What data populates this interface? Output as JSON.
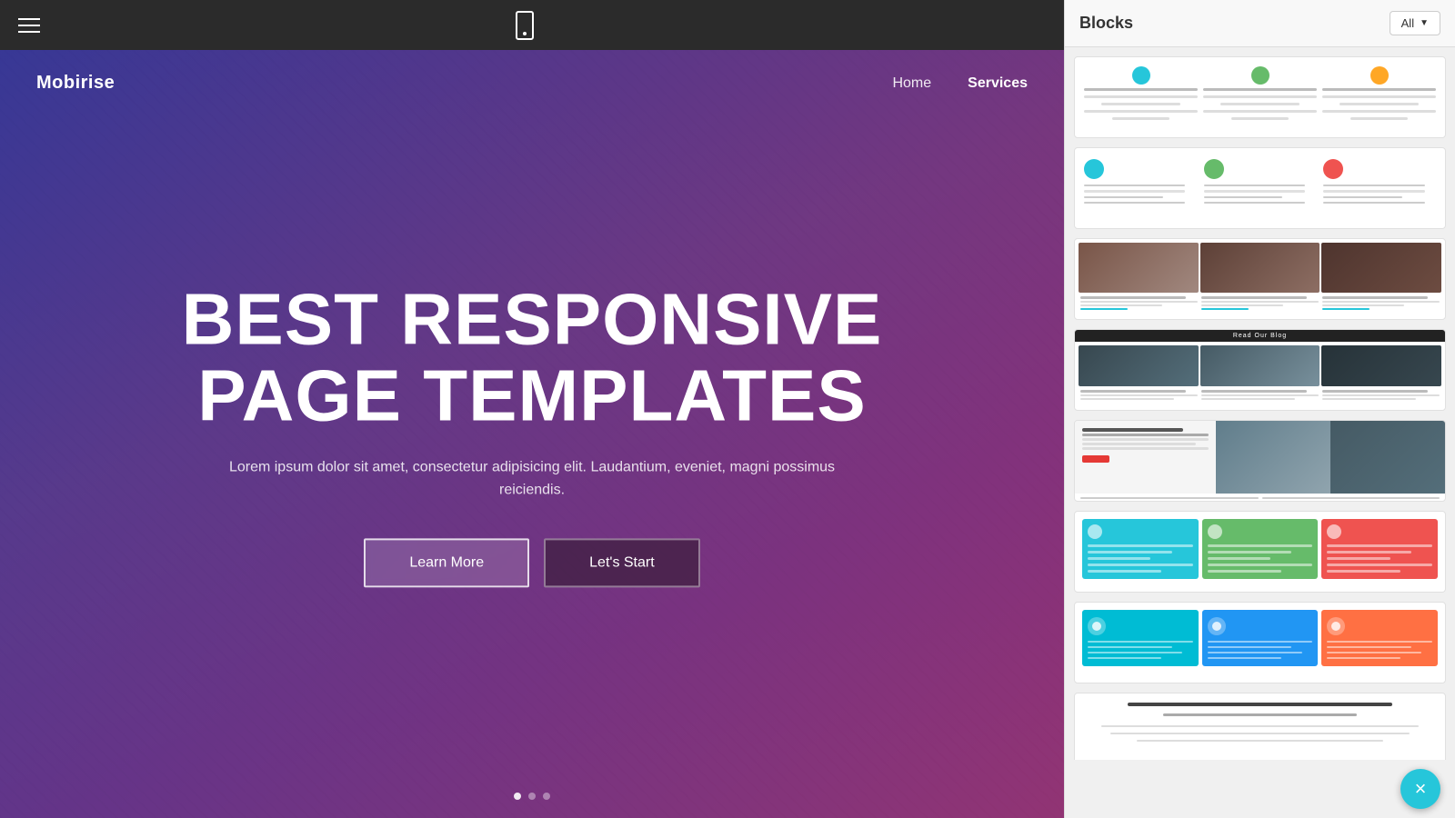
{
  "toolbar": {
    "hamburger_label": "Menu"
  },
  "nav": {
    "logo": "Mobirise",
    "links": [
      {
        "label": "Home",
        "active": false
      },
      {
        "label": "Services",
        "active": true
      }
    ]
  },
  "hero": {
    "title_line1": "BEST RESPONSIVE",
    "title_line2": "PAGE TEMPLATES",
    "subtitle": "Lorem ipsum dolor sit amet, consectetur adipisicing elit. Laudantium, eveniet, magni possimus reiciendis.",
    "btn_learn_more": "Learn More",
    "btn_lets_start": "Let's Start"
  },
  "panel": {
    "title": "Blocks",
    "filter_label": "All",
    "close_label": "×"
  },
  "blocks": [
    {
      "id": 1,
      "type": "icons-row"
    },
    {
      "id": 2,
      "type": "circles-row"
    },
    {
      "id": 3,
      "type": "photos-row"
    },
    {
      "id": 4,
      "type": "blog-grid"
    },
    {
      "id": 5,
      "type": "dev-direction"
    },
    {
      "id": 6,
      "type": "colored-cards"
    },
    {
      "id": 7,
      "type": "teal-blue-orange"
    },
    {
      "id": 8,
      "type": "text-block"
    }
  ]
}
